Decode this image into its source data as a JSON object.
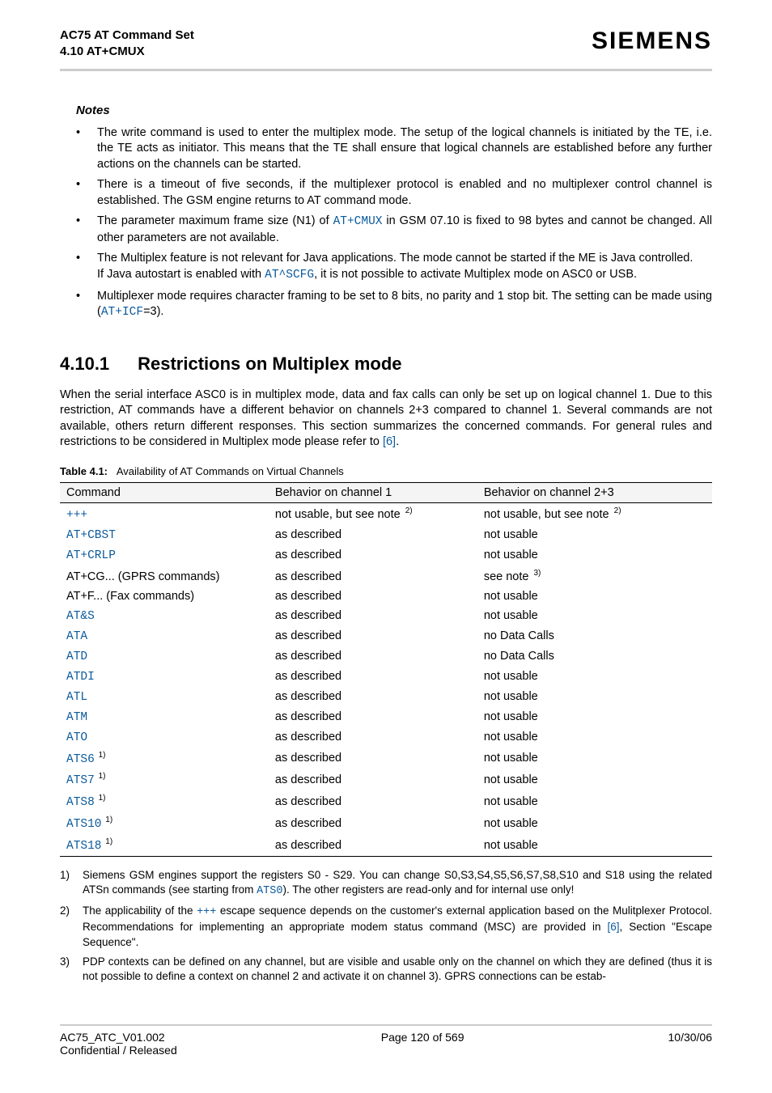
{
  "header": {
    "title1": "AC75 AT Command Set",
    "title2": "4.10 AT+CMUX",
    "brand": "SIEMENS"
  },
  "notes_heading": "Notes",
  "notes": [
    {
      "parts": [
        {
          "t": "The write command is used to enter the multiplex mode. The setup of the logical channels is initiated by the TE, i.e. the TE acts as initiator. This means that the TE shall ensure that logical channels are established before any further actions on the channels can be started."
        }
      ]
    },
    {
      "parts": [
        {
          "t": "There is a timeout of five seconds, if the multiplexer protocol is enabled and no multiplexer control channel is established. The GSM engine returns to AT command mode."
        }
      ]
    },
    {
      "parts": [
        {
          "t": "The parameter maximum frame size (N1) of "
        },
        {
          "t": "AT+CMUX",
          "cls": "mono"
        },
        {
          "t": " in GSM 07.10 is fixed to 98 bytes and cannot be changed. All other parameters are not available."
        }
      ]
    },
    {
      "parts": [
        {
          "t": "The Multiplex feature is not relevant for Java applications. The mode cannot be started if the ME is Java controlled."
        },
        {
          "br": true
        },
        {
          "t": "If Java autostart is enabled with "
        },
        {
          "t": "AT^SCFG",
          "cls": "mono"
        },
        {
          "t": ", it is not possible to activate Multiplex mode on ASC0 or USB."
        }
      ]
    },
    {
      "parts": [
        {
          "t": "Multiplexer mode requires character framing to be set to 8 bits, no parity and 1 stop bit. The setting can be made using ("
        },
        {
          "t": "AT+ICF",
          "cls": "mono"
        },
        {
          "t": "=3)."
        }
      ]
    }
  ],
  "section": {
    "number": "4.10.1",
    "title": "Restrictions on Multiplex mode"
  },
  "intro_para": {
    "parts": [
      {
        "t": "When the serial interface ASC0 is in multiplex mode, data and fax calls can only be set up on logical channel 1. Due to this restriction, AT commands have a different behavior on channels 2+3 compared to channel 1. Several commands are not available, others return different responses. This section summarizes the concerned commands. For general rules and restrictions to be considered in Multiplex mode please refer to "
      },
      {
        "t": "[6]",
        "cls": "link"
      },
      {
        "t": "."
      }
    ]
  },
  "table": {
    "caption_label": "Table 4.1:",
    "caption_text": "Availability of AT Commands on Virtual Channels",
    "headers": [
      "Command",
      "Behavior on channel 1",
      "Behavior on channel 2+3"
    ],
    "rows": [
      {
        "cmd": [
          {
            "t": "+++",
            "cls": "mono"
          }
        ],
        "c1": [
          {
            "t": "not usable, but see note "
          },
          {
            "t": "2)",
            "sup": true
          }
        ],
        "c2": [
          {
            "t": "not usable, but see note "
          },
          {
            "t": "2)",
            "sup": true
          }
        ]
      },
      {
        "cmd": [
          {
            "t": "AT+CBST",
            "cls": "mono"
          }
        ],
        "c1": [
          {
            "t": "as described"
          }
        ],
        "c2": [
          {
            "t": "not usable"
          }
        ]
      },
      {
        "cmd": [
          {
            "t": "AT+CRLP",
            "cls": "mono"
          }
        ],
        "c1": [
          {
            "t": "as described"
          }
        ],
        "c2": [
          {
            "t": "not usable"
          }
        ]
      },
      {
        "cmd": [
          {
            "t": "AT+CG... (GPRS commands)"
          }
        ],
        "c1": [
          {
            "t": "as described"
          }
        ],
        "c2": [
          {
            "t": "see note "
          },
          {
            "t": "3)",
            "sup": true
          }
        ]
      },
      {
        "cmd": [
          {
            "t": "AT+F... (Fax commands)"
          }
        ],
        "c1": [
          {
            "t": "as described"
          }
        ],
        "c2": [
          {
            "t": "not usable"
          }
        ]
      },
      {
        "cmd": [
          {
            "t": "AT&S",
            "cls": "mono"
          }
        ],
        "c1": [
          {
            "t": "as described"
          }
        ],
        "c2": [
          {
            "t": "not usable"
          }
        ]
      },
      {
        "cmd": [
          {
            "t": "ATA",
            "cls": "mono"
          }
        ],
        "c1": [
          {
            "t": "as described"
          }
        ],
        "c2": [
          {
            "t": "no Data Calls"
          }
        ]
      },
      {
        "cmd": [
          {
            "t": "ATD",
            "cls": "mono"
          }
        ],
        "c1": [
          {
            "t": "as described"
          }
        ],
        "c2": [
          {
            "t": "no Data Calls"
          }
        ]
      },
      {
        "cmd": [
          {
            "t": "ATDI",
            "cls": "mono"
          }
        ],
        "c1": [
          {
            "t": "as described"
          }
        ],
        "c2": [
          {
            "t": "not usable"
          }
        ]
      },
      {
        "cmd": [
          {
            "t": "ATL",
            "cls": "mono"
          }
        ],
        "c1": [
          {
            "t": "as described"
          }
        ],
        "c2": [
          {
            "t": "not usable"
          }
        ]
      },
      {
        "cmd": [
          {
            "t": "ATM",
            "cls": "mono"
          }
        ],
        "c1": [
          {
            "t": "as described"
          }
        ],
        "c2": [
          {
            "t": "not usable"
          }
        ]
      },
      {
        "cmd": [
          {
            "t": "ATO",
            "cls": "mono"
          }
        ],
        "c1": [
          {
            "t": "as described"
          }
        ],
        "c2": [
          {
            "t": "not usable"
          }
        ]
      },
      {
        "cmd": [
          {
            "t": "ATS6",
            "cls": "mono"
          },
          {
            "t": " 1)",
            "sup": true
          }
        ],
        "c1": [
          {
            "t": "as described"
          }
        ],
        "c2": [
          {
            "t": "not usable"
          }
        ]
      },
      {
        "cmd": [
          {
            "t": "ATS7",
            "cls": "mono"
          },
          {
            "t": " 1)",
            "sup": true
          }
        ],
        "c1": [
          {
            "t": "as described"
          }
        ],
        "c2": [
          {
            "t": "not usable"
          }
        ]
      },
      {
        "cmd": [
          {
            "t": "ATS8",
            "cls": "mono"
          },
          {
            "t": " 1)",
            "sup": true
          }
        ],
        "c1": [
          {
            "t": "as described"
          }
        ],
        "c2": [
          {
            "t": "not usable"
          }
        ]
      },
      {
        "cmd": [
          {
            "t": "ATS10",
            "cls": "mono"
          },
          {
            "t": " 1)",
            "sup": true
          }
        ],
        "c1": [
          {
            "t": "as described"
          }
        ],
        "c2": [
          {
            "t": "not usable"
          }
        ]
      },
      {
        "cmd": [
          {
            "t": "ATS18",
            "cls": "mono"
          },
          {
            "t": " 1)",
            "sup": true
          }
        ],
        "c1": [
          {
            "t": "as described"
          }
        ],
        "c2": [
          {
            "t": "not usable"
          }
        ]
      }
    ]
  },
  "footnotes": [
    {
      "n": "1)",
      "parts": [
        {
          "t": "Siemens GSM engines support the registers S0 - S29. You can change S0,S3,S4,S5,S6,S7,S8,S10 and S18 using the related ATSn commands (see starting from "
        },
        {
          "t": "ATS0",
          "cls": "mono"
        },
        {
          "t": "). The other registers are read-only and for internal use only!"
        }
      ]
    },
    {
      "n": "2)",
      "parts": [
        {
          "t": "The applicability of the "
        },
        {
          "t": "+++",
          "cls": "mono"
        },
        {
          "t": " escape sequence depends on the customer's external application based on the Mulitplexer Protocol. Recommendations for implementing an appropriate modem status command (MSC) are provided in "
        },
        {
          "t": "[6]",
          "cls": "link"
        },
        {
          "t": ", Section \"Escape Sequence\"."
        }
      ]
    },
    {
      "n": "3)",
      "parts": [
        {
          "t": "PDP contexts can be defined on any channel, but are visible and usable only on the channel on which they are defined (thus it is not possible to define a context on channel 2 and activate it on channel 3). GPRS connections can be estab-"
        }
      ]
    }
  ],
  "footer": {
    "left1": "AC75_ATC_V01.002",
    "left2": "Confidential / Released",
    "center": "Page 120 of 569",
    "right": "10/30/06"
  }
}
